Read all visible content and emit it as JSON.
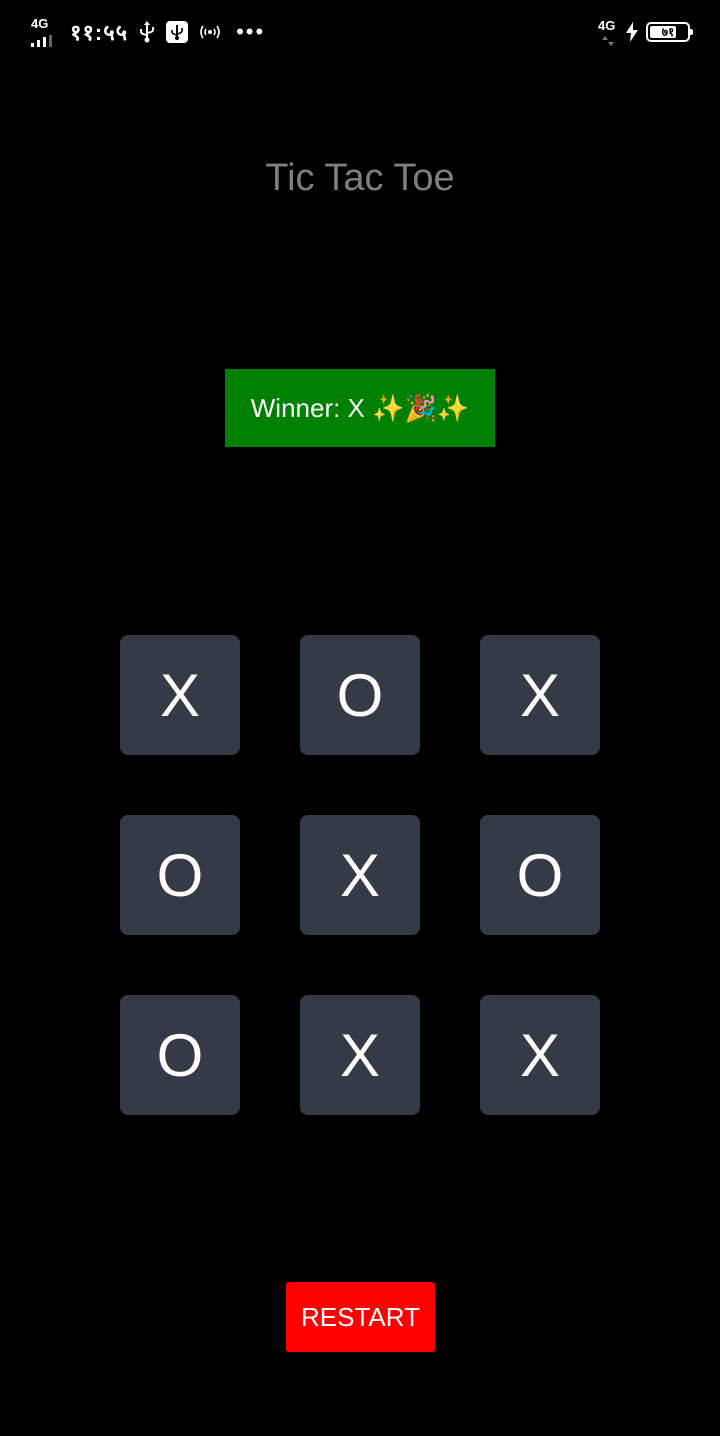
{
  "status_bar": {
    "network_left": "4G",
    "time": "११:५५",
    "icons_left": [
      "usb-icon",
      "usb-debugging-icon",
      "hotspot-icon"
    ],
    "more": "•••",
    "network_right": "4G",
    "charging_icon": "bolt-icon",
    "battery_level": "७१",
    "battery_fraction": 0.71
  },
  "app": {
    "title": "Tic Tac Toe",
    "winner_text": "Winner: X ✨🎉✨",
    "board": [
      [
        "X",
        "O",
        "X"
      ],
      [
        "O",
        "X",
        "O"
      ],
      [
        "O",
        "X",
        "X"
      ]
    ],
    "restart_label": "RESTART"
  },
  "colors": {
    "background": "#000000",
    "title": "#7f7f7f",
    "winner_banner": "#008000",
    "cell": "#343a46",
    "restart_button": "#ff0000"
  }
}
